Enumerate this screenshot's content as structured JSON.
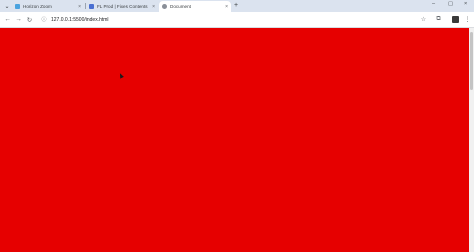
{
  "browser": {
    "tabs": [
      {
        "label": "Horizon Zoom",
        "favicon_color": "#4aa3df",
        "active": false
      },
      {
        "label": "FL Prod | Fixes Contents",
        "favicon_color": "#4a6fd1",
        "active": false
      },
      {
        "label": "Document",
        "favicon_color": "#8a8f98",
        "active": true
      }
    ],
    "tab_close_glyph": "×",
    "new_tab_glyph": "+",
    "window_controls": {
      "minimize": "–",
      "maximize": "▢",
      "close": "×"
    },
    "toolbar": {
      "back_glyph": "←",
      "forward_glyph": "→",
      "reload_glyph": "↻",
      "url": "127.0.0.1:5500/index.html",
      "site_info_glyph": "ⓘ",
      "bookmark_glyph": "☆",
      "extensions_glyph": "⧉",
      "menu_glyph": "⋮"
    }
  },
  "page": {
    "background_color": "#e60000"
  }
}
